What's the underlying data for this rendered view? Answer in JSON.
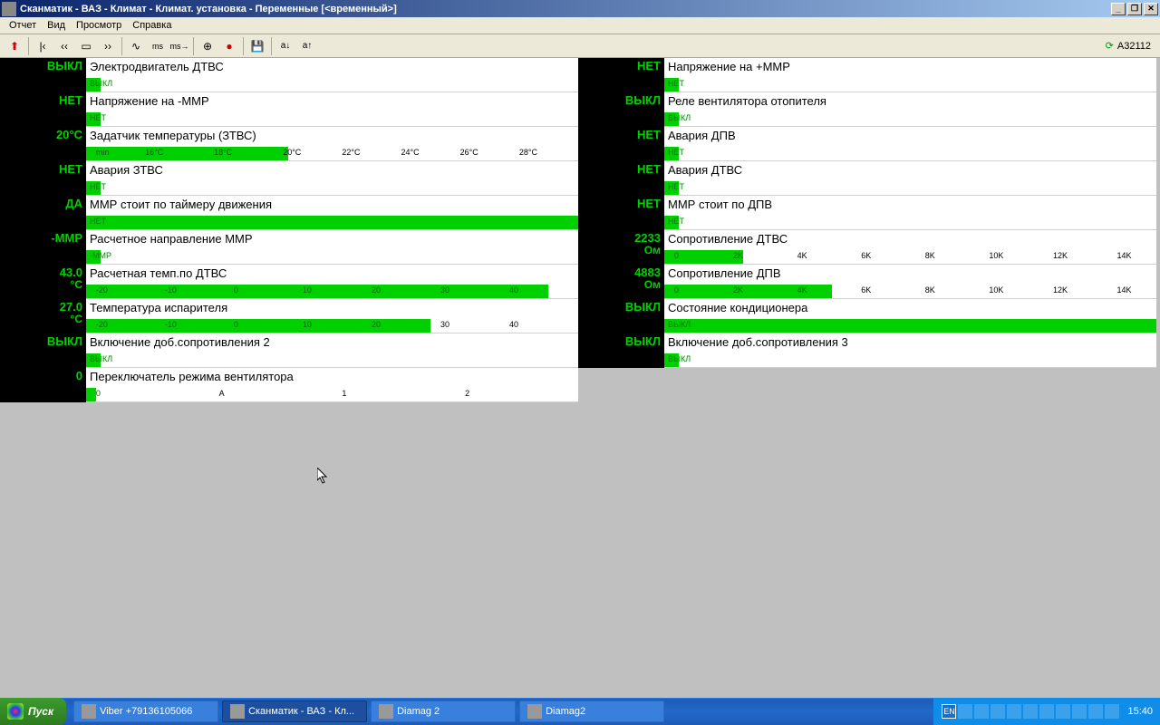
{
  "title": "Сканматик - ВАЗ - Климат - Климат. установка - Переменные [<временный>]",
  "menu": {
    "report": "Отчет",
    "view": "Вид",
    "browse": "Просмотр",
    "help": "Справка"
  },
  "toolbar_status": "A32112",
  "cols": {
    "left": [
      {
        "val": "ВЫКЛ",
        "unit": "",
        "name": "Электродвигатель ДТВС",
        "state": "ВЫКЛ",
        "barPct": 3
      },
      {
        "val": "НЕТ",
        "unit": "",
        "name": "Напряжение на -ММР",
        "state": "НЕТ",
        "barPct": 3
      },
      {
        "val": "20",
        "unit": "°C",
        "name": "Задатчик температуры (ЗТВС)",
        "state": "",
        "barPct": 41,
        "ticks": [
          {
            "t": "min",
            "p": 2,
            "on": true
          },
          {
            "t": "16°C",
            "p": 12,
            "on": true
          },
          {
            "t": "18°C",
            "p": 26,
            "on": true
          },
          {
            "t": "20°C",
            "p": 40,
            "on": false
          },
          {
            "t": "22°C",
            "p": 52,
            "on": false
          },
          {
            "t": "24°C",
            "p": 64,
            "on": false
          },
          {
            "t": "26°C",
            "p": 76,
            "on": false
          },
          {
            "t": "28°C",
            "p": 88,
            "on": false
          }
        ]
      },
      {
        "val": "НЕТ",
        "unit": "",
        "name": "Авария ЗТВС",
        "state": "НЕТ",
        "barPct": 3
      },
      {
        "val": "ДА",
        "unit": "",
        "name": "ММР стоит по таймеру движения",
        "state": "НЕТ",
        "barPct": 100
      },
      {
        "val": "-ММР",
        "unit": "",
        "name": "Расчетное направление ММР",
        "state": "-ММР",
        "barPct": 3
      },
      {
        "val": "43.0",
        "unit": "°C",
        "name": "Расчетная темп.по ДТВС",
        "state": "",
        "barPct": 94,
        "ticks": [
          {
            "t": "-20",
            "p": 2,
            "on": true
          },
          {
            "t": "-10",
            "p": 16,
            "on": true
          },
          {
            "t": "0",
            "p": 30,
            "on": true
          },
          {
            "t": "10",
            "p": 44,
            "on": true
          },
          {
            "t": "20",
            "p": 58,
            "on": true
          },
          {
            "t": "30",
            "p": 72,
            "on": true
          },
          {
            "t": "40",
            "p": 86,
            "on": true
          }
        ]
      },
      {
        "val": "27.0",
        "unit": "°C",
        "name": "Температура испарителя",
        "state": "",
        "barPct": 70,
        "ticks": [
          {
            "t": "-20",
            "p": 2,
            "on": true
          },
          {
            "t": "-10",
            "p": 16,
            "on": true
          },
          {
            "t": "0",
            "p": 30,
            "on": true
          },
          {
            "t": "10",
            "p": 44,
            "on": true
          },
          {
            "t": "20",
            "p": 58,
            "on": true
          },
          {
            "t": "30",
            "p": 72,
            "on": false
          },
          {
            "t": "40",
            "p": 86,
            "on": false
          }
        ]
      },
      {
        "val": "ВЫКЛ",
        "unit": "",
        "name": "Включение доб.сопротивления 2",
        "state": "ВЫКЛ",
        "barPct": 3
      },
      {
        "val": "0",
        "unit": "",
        "name": "Переключатель режима вентилятора",
        "state": "",
        "barPct": 2,
        "ticks": [
          {
            "t": "0",
            "p": 2,
            "on": true
          },
          {
            "t": "A",
            "p": 27,
            "on": false
          },
          {
            "t": "1",
            "p": 52,
            "on": false
          },
          {
            "t": "2",
            "p": 77,
            "on": false
          }
        ]
      }
    ],
    "right": [
      {
        "val": "НЕТ",
        "unit": "",
        "name": "Напряжение на +ММР",
        "state": "НЕТ",
        "barPct": 3
      },
      {
        "val": "ВЫКЛ",
        "unit": "",
        "name": "Реле вентилятора отопителя",
        "state": "ВЫКЛ",
        "barPct": 3
      },
      {
        "val": "НЕТ",
        "unit": "",
        "name": "Авария ДПВ",
        "state": "НЕТ",
        "barPct": 3
      },
      {
        "val": "НЕТ",
        "unit": "",
        "name": "Авария ДТВС",
        "state": "НЕТ",
        "barPct": 3
      },
      {
        "val": "НЕТ",
        "unit": "",
        "name": "ММР стоит по ДПВ",
        "state": "НЕТ",
        "barPct": 3
      },
      {
        "val": "2233",
        "unit": "Ом",
        "name": "Сопротивление ДТВС",
        "state": "",
        "barPct": 16,
        "ticks": [
          {
            "t": "0",
            "p": 2,
            "on": true
          },
          {
            "t": "2K",
            "p": 14,
            "on": true
          },
          {
            "t": "4K",
            "p": 27,
            "on": false
          },
          {
            "t": "6K",
            "p": 40,
            "on": false
          },
          {
            "t": "8K",
            "p": 53,
            "on": false
          },
          {
            "t": "10K",
            "p": 66,
            "on": false
          },
          {
            "t": "12K",
            "p": 79,
            "on": false
          },
          {
            "t": "14K",
            "p": 92,
            "on": false
          }
        ]
      },
      {
        "val": "4883",
        "unit": "Ом",
        "name": "Сопротивление ДПВ",
        "state": "",
        "barPct": 34,
        "ticks": [
          {
            "t": "0",
            "p": 2,
            "on": true
          },
          {
            "t": "2K",
            "p": 14,
            "on": true
          },
          {
            "t": "4K",
            "p": 27,
            "on": true
          },
          {
            "t": "6K",
            "p": 40,
            "on": false
          },
          {
            "t": "8K",
            "p": 53,
            "on": false
          },
          {
            "t": "10K",
            "p": 66,
            "on": false
          },
          {
            "t": "12K",
            "p": 79,
            "on": false
          },
          {
            "t": "14K",
            "p": 92,
            "on": false
          }
        ]
      },
      {
        "val": "ВЫКЛ",
        "unit": "",
        "name": "Состояние кондиционера",
        "state": "ВЫКЛ",
        "barPct": 100
      },
      {
        "val": "ВЫКЛ",
        "unit": "",
        "name": "Включение доб.сопротивления 3",
        "state": "ВЫКЛ",
        "barPct": 3
      }
    ]
  },
  "taskbar": {
    "start": "Пуск",
    "items": [
      {
        "label": "Viber +79136105066",
        "active": false
      },
      {
        "label": "Сканматик - ВАЗ - Кл...",
        "active": true
      },
      {
        "label": "Diamag 2",
        "active": false
      },
      {
        "label": "Diamag2",
        "active": false
      }
    ],
    "lang": "EN",
    "clock": "15:40"
  }
}
